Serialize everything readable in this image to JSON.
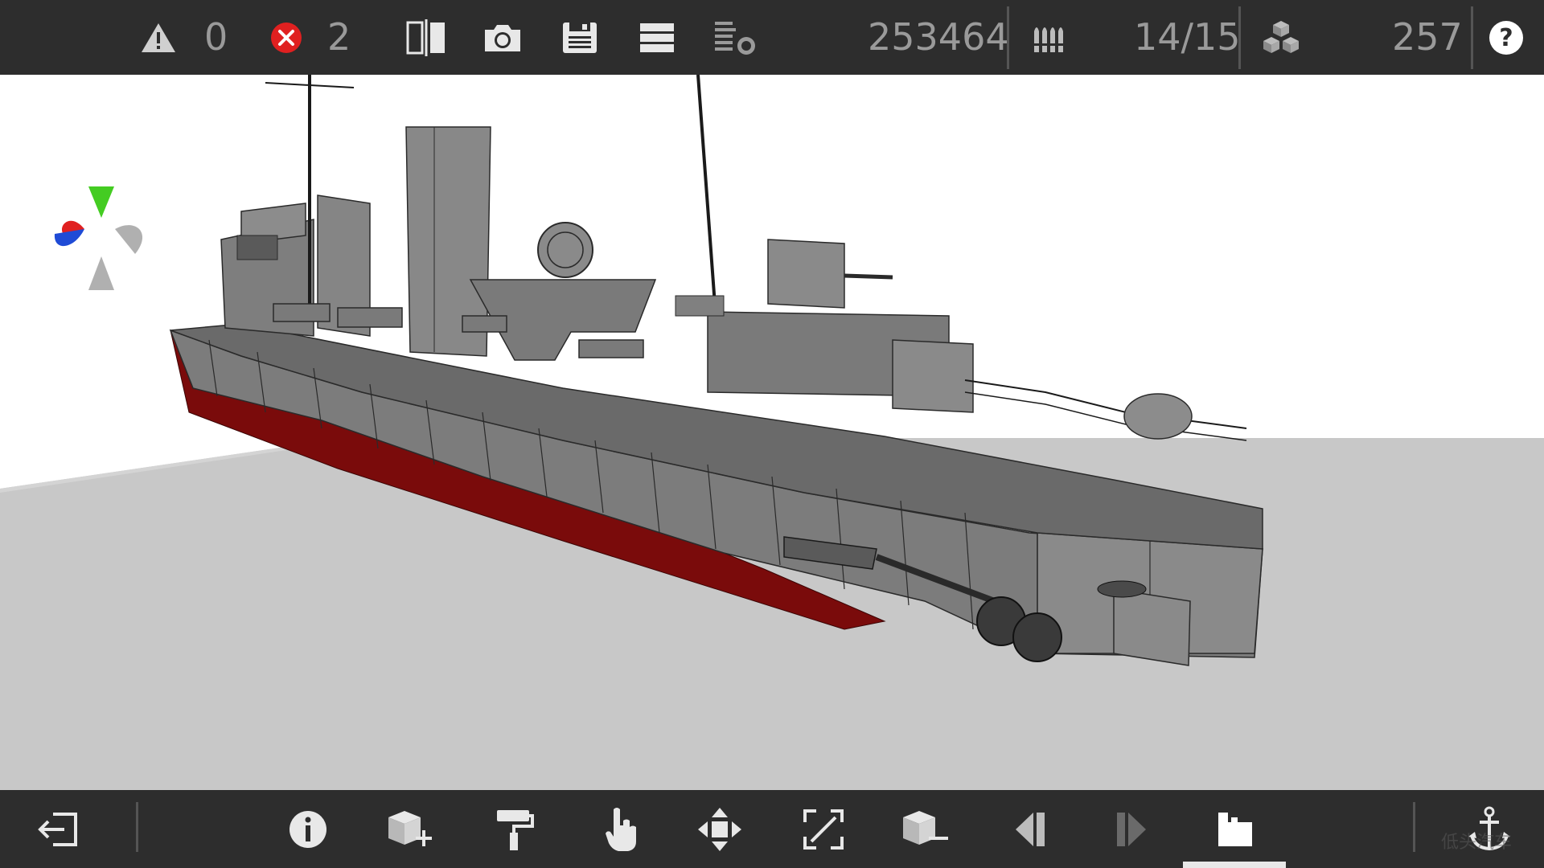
{
  "toolbar": {
    "warnings_count": "0",
    "errors_count": "2",
    "block_count": "253464",
    "weapons_count": "14/15",
    "parts_count": "257"
  },
  "icons": {
    "warning": "warning-triangle-icon",
    "error": "error-x-icon",
    "mirror": "mirror-symmetry-icon",
    "camera": "camera-screenshot-icon",
    "save": "save-disk-icon",
    "layers": "layers-list-icon",
    "stats": "statistics-icon",
    "ammo": "ammo-shells-icon",
    "parts": "parts-cubes-icon",
    "help": "help-question-icon",
    "exit": "exit-door-icon",
    "info": "info-icon",
    "add_block": "add-block-icon",
    "paint": "paint-roller-icon",
    "select": "hand-pointer-icon",
    "move": "move-arrows-icon",
    "scale": "scale-icon",
    "remove_block": "remove-block-icon",
    "undo": "undo-icon",
    "redo": "redo-icon",
    "build_mode": "build-mode-icon",
    "anchor": "anchor-icon"
  },
  "colors": {
    "bar": "#2d2d2d",
    "icon": "#e8e8e8",
    "error_red": "#e02020",
    "hull_grey": "#7a7a7a",
    "hull_red": "#7a0b0b",
    "floor": "#c8c8c8"
  },
  "watermark": "低头汽车"
}
